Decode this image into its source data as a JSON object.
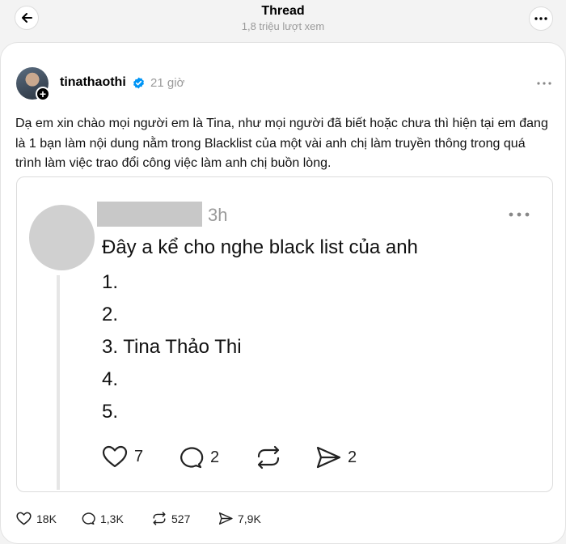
{
  "header": {
    "title": "Thread",
    "views": "1,8 triệu lượt xem"
  },
  "post": {
    "username": "tinathaothi",
    "time": "21 giờ",
    "text": "Dạ em xin chào mọi người em là Tina, như mọi người đã biết hoặc chưa thì hiện tại em đang là 1 bạn làm nội dung nằm trong Blacklist của một vài anh chị làm truyền thông trong quá trình làm việc trao đổi công việc làm anh chị buồn lòng.",
    "likes": "18K",
    "comments": "1,3K",
    "reposts": "527",
    "shares": "7,9K"
  },
  "quote": {
    "time": "3h",
    "lines": [
      "Đây a kể cho nghe black list của anh",
      "1.",
      "2.",
      "3. Tina Thảo Thi",
      "4.",
      "5."
    ],
    "likes": "7",
    "comments": "2",
    "shares": "2"
  },
  "colors": {
    "verified": "#0095f6",
    "muted": "#9a9a9a"
  },
  "icons": [
    "back-arrow-icon",
    "more-icon",
    "verified-icon",
    "heart-icon",
    "comment-icon",
    "repost-icon",
    "share-icon"
  ]
}
